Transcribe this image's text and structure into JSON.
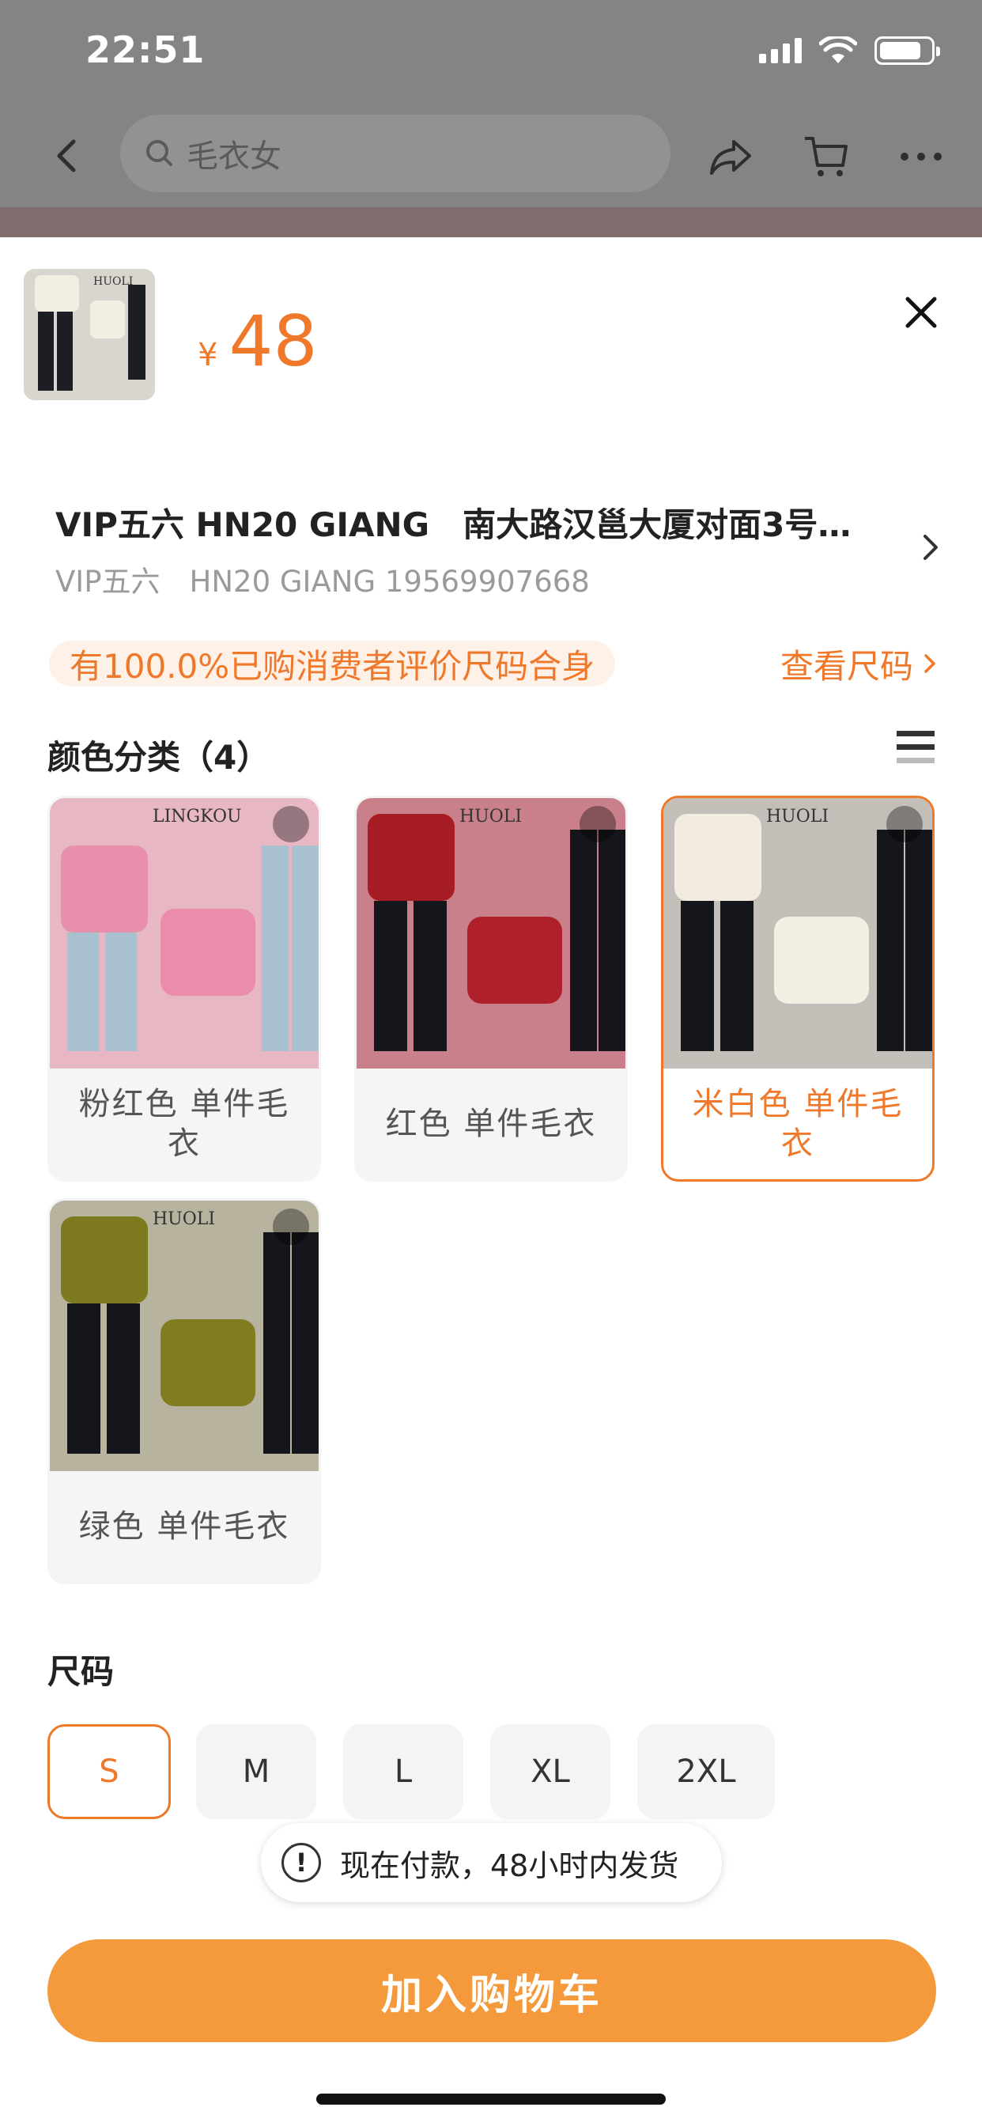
{
  "status_bar": {
    "time": "22:51"
  },
  "top_nav": {
    "search_placeholder": "毛衣女"
  },
  "product": {
    "currency": "¥",
    "price": "48"
  },
  "address": {
    "line1": "VIP五六 HN20 GIANG　南大路汉邕大厦对面3号…",
    "line2": "VIP五六　HN20 GIANG 19569907668"
  },
  "size_tip": {
    "text": "有100.0%已购消费者评价尺码合身",
    "link": "查看尺码"
  },
  "color_section": {
    "title": "颜色分类（4）",
    "options": [
      {
        "label": "粉红色 单件毛衣",
        "color": "#e8a9b8",
        "selected": false
      },
      {
        "label": "红色 单件毛衣",
        "color": "#a0202a",
        "selected": false
      },
      {
        "label": "米白色 单件毛衣",
        "color": "#efe8da",
        "selected": true
      },
      {
        "label": "绿色 单件毛衣",
        "color": "#7c7a22",
        "selected": false
      }
    ]
  },
  "size_section": {
    "title": "尺码",
    "options": [
      {
        "label": "S",
        "selected": true
      },
      {
        "label": "M",
        "selected": false
      },
      {
        "label": "L",
        "selected": false
      },
      {
        "label": "XL",
        "selected": false
      },
      {
        "label": "2XL",
        "selected": false
      }
    ]
  },
  "toast": {
    "icon": "!",
    "text": "现在付款，48小时内发货"
  },
  "cta": {
    "label": "加入购物车"
  },
  "colors": {
    "accent": "#f0782a",
    "cta": "#f49a3c"
  }
}
